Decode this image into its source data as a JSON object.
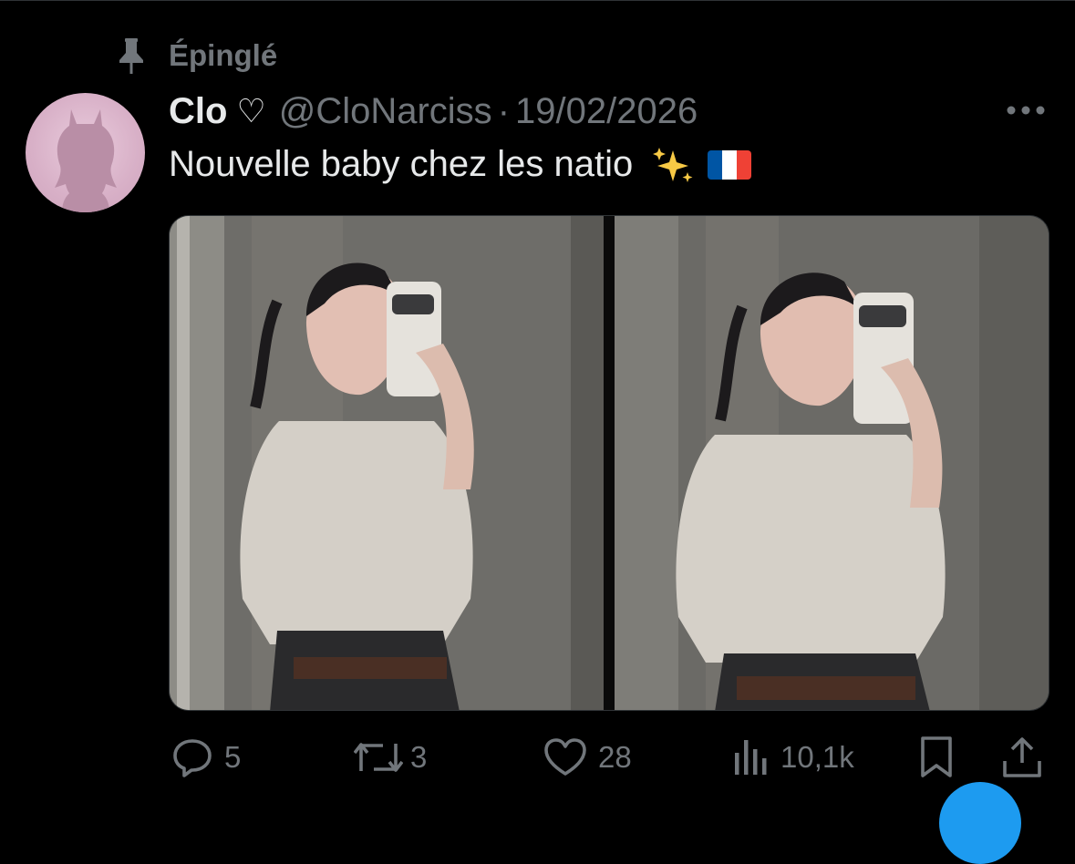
{
  "pinned": {
    "label": "Épinglé"
  },
  "tweet": {
    "author_name": "Clo",
    "author_name_heart": "♡",
    "handle": "@CloNarciss",
    "separator": "·",
    "date": "19/02/2026",
    "text": "Nouvelle baby chez les natio",
    "text_emojis": [
      "sparkles-icon",
      "france-flag-icon"
    ]
  },
  "media": {
    "photos": [
      {
        "name": "mirror-selfie-photo-1"
      },
      {
        "name": "mirror-selfie-photo-2"
      }
    ]
  },
  "actions": {
    "reply_count": "5",
    "retweet_count": "3",
    "like_count": "28",
    "views_count": "10,1k"
  },
  "colors": {
    "background": "#000000",
    "text_primary": "#e7e9ea",
    "text_secondary": "#71767b",
    "accent": "#1d9bf0",
    "avatar_bg": "#d8b0c7",
    "flag_blue": "#0055a4",
    "flag_white": "#ffffff",
    "flag_red": "#ef4135"
  }
}
